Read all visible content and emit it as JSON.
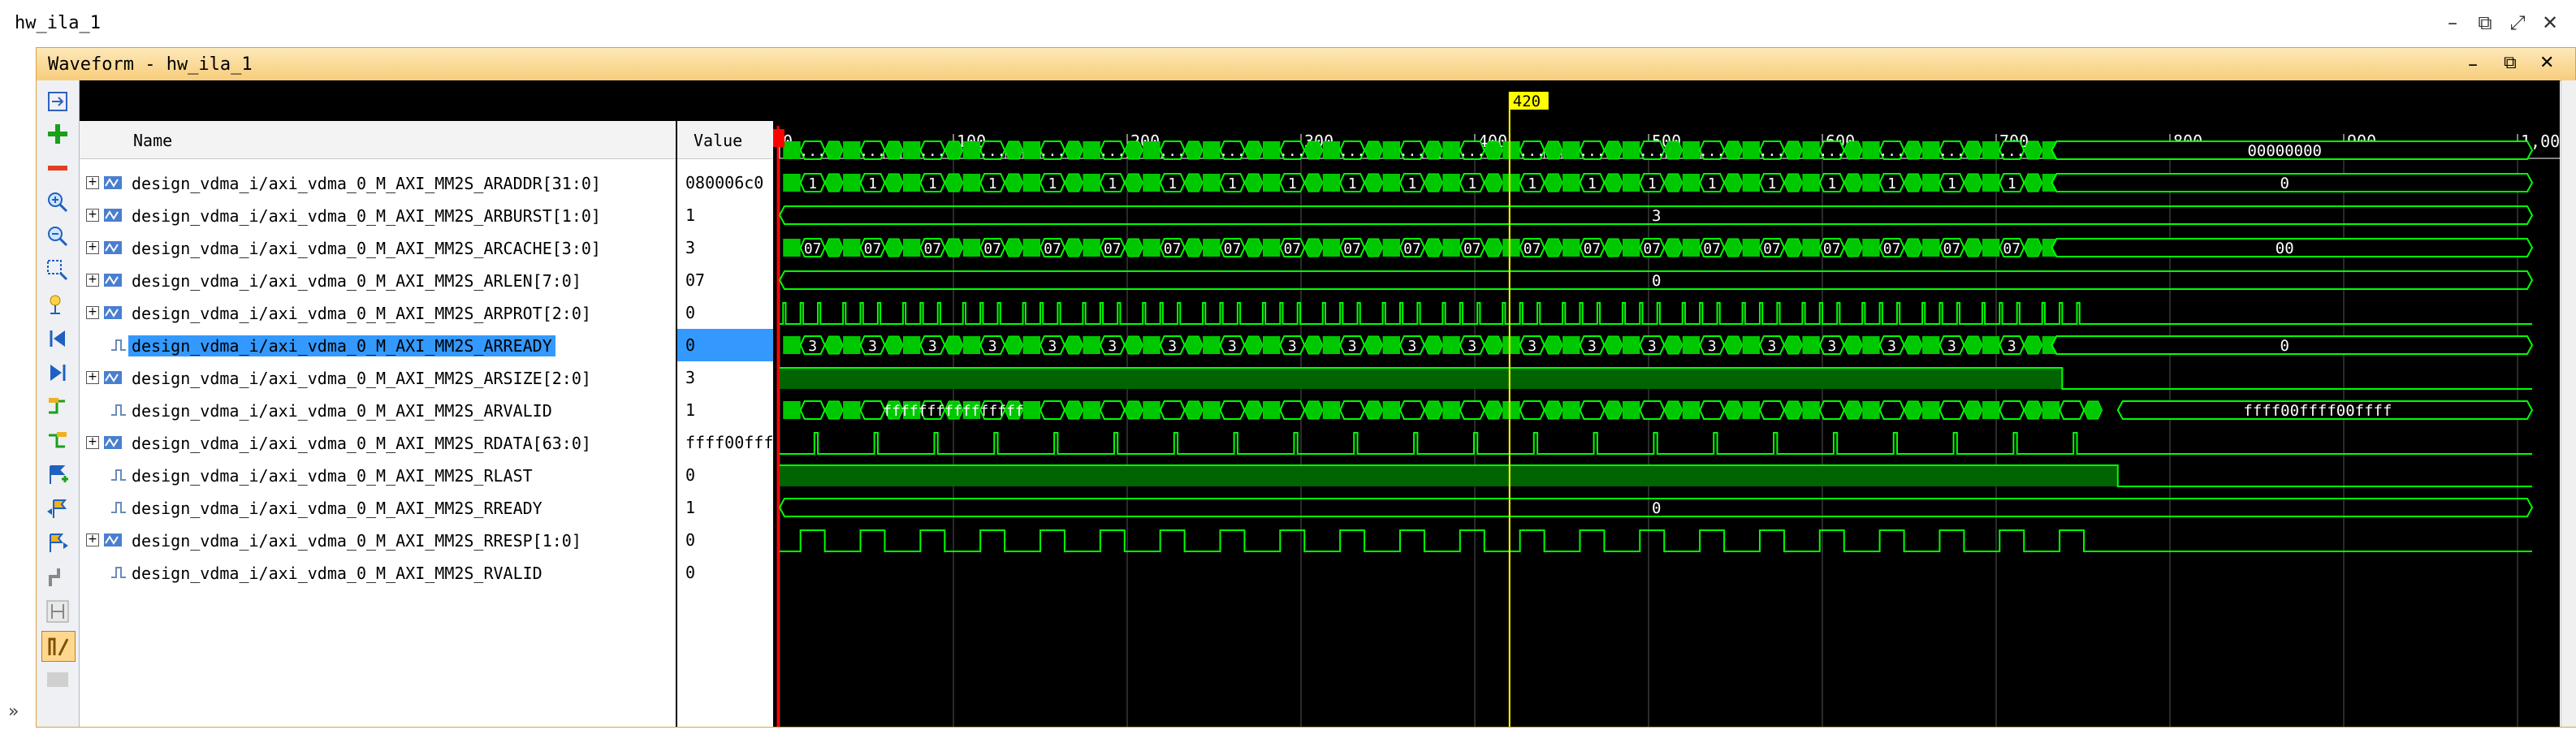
{
  "window_title": "hw_ila_1",
  "panel_title": "Waveform - hw_ila_1",
  "cursor_label": "420",
  "cursor_at": 420,
  "time_range": [
    0,
    1000
  ],
  "ruler_labels": [
    "0",
    "100",
    "200",
    "300",
    "400",
    "500",
    "600",
    "700",
    "800",
    "900",
    "1,000"
  ],
  "header": {
    "name": "Name",
    "value": "Value"
  },
  "colors": {
    "wave": "#00ff00",
    "bus_fill": "#00c800",
    "cursor": "#ffff00",
    "trigger": "#ff0000",
    "select": "#3399ff",
    "valid_fill": "#006400"
  },
  "toolbar_icons": [
    "zoom-fit-icon",
    "add-icon",
    "remove-icon",
    "zoom-in-icon",
    "zoom-out-icon",
    "zoom-area-icon",
    "cursor-icon",
    "go-first-icon",
    "go-last-icon",
    "prev-edge-icon",
    "next-edge-icon",
    "add-marker-icon",
    "prev-marker-icon",
    "next-marker-icon",
    "swap-icon",
    "snap-icon"
  ],
  "signals": [
    {
      "name": "design_vdma_i/axi_vdma_0_M_AXI_MM2S_ARADDR[31:0]",
      "value": "080006c0",
      "bus": true,
      "selected": false,
      "label": "...",
      "idle": "00000000"
    },
    {
      "name": "design_vdma_i/axi_vdma_0_M_AXI_MM2S_ARBURST[1:0]",
      "value": "1",
      "bus": true,
      "selected": false,
      "label": "1",
      "idle": "0"
    },
    {
      "name": "design_vdma_i/axi_vdma_0_M_AXI_MM2S_ARCACHE[3:0]",
      "value": "3",
      "bus": true,
      "selected": false,
      "label": "",
      "idle": "3"
    },
    {
      "name": "design_vdma_i/axi_vdma_0_M_AXI_MM2S_ARLEN[7:0]",
      "value": "07",
      "bus": true,
      "selected": false,
      "label": "07",
      "idle": "00"
    },
    {
      "name": "design_vdma_i/axi_vdma_0_M_AXI_MM2S_ARPROT[2:0]",
      "value": "0",
      "bus": true,
      "selected": false,
      "label": "",
      "idle": "0"
    },
    {
      "name": "design_vdma_i/axi_vdma_0_M_AXI_MM2S_ARREADY",
      "value": "0",
      "bus": false,
      "selected": true
    },
    {
      "name": "design_vdma_i/axi_vdma_0_M_AXI_MM2S_ARSIZE[2:0]",
      "value": "3",
      "bus": true,
      "selected": false,
      "label": "3",
      "idle": "0"
    },
    {
      "name": "design_vdma_i/axi_vdma_0_M_AXI_MM2S_ARVALID",
      "value": "1",
      "bus": false,
      "selected": false
    },
    {
      "name": "design_vdma_i/axi_vdma_0_M_AXI_MM2S_RDATA[63:0]",
      "value": "ffff00ffff00ffff",
      "bus": true,
      "selected": false,
      "label": "ffffffffffffffff",
      "idle": "ffff00ffff00ffff"
    },
    {
      "name": "design_vdma_i/axi_vdma_0_M_AXI_MM2S_RLAST",
      "value": "0",
      "bus": false,
      "selected": false
    },
    {
      "name": "design_vdma_i/axi_vdma_0_M_AXI_MM2S_RREADY",
      "value": "1",
      "bus": false,
      "selected": false
    },
    {
      "name": "design_vdma_i/axi_vdma_0_M_AXI_MM2S_RRESP[1:0]",
      "value": "0",
      "bus": true,
      "selected": false,
      "label": "",
      "idle": "0"
    },
    {
      "name": "design_vdma_i/axi_vdma_0_M_AXI_MM2S_RVALID",
      "value": "0",
      "bus": false,
      "selected": false
    }
  ]
}
